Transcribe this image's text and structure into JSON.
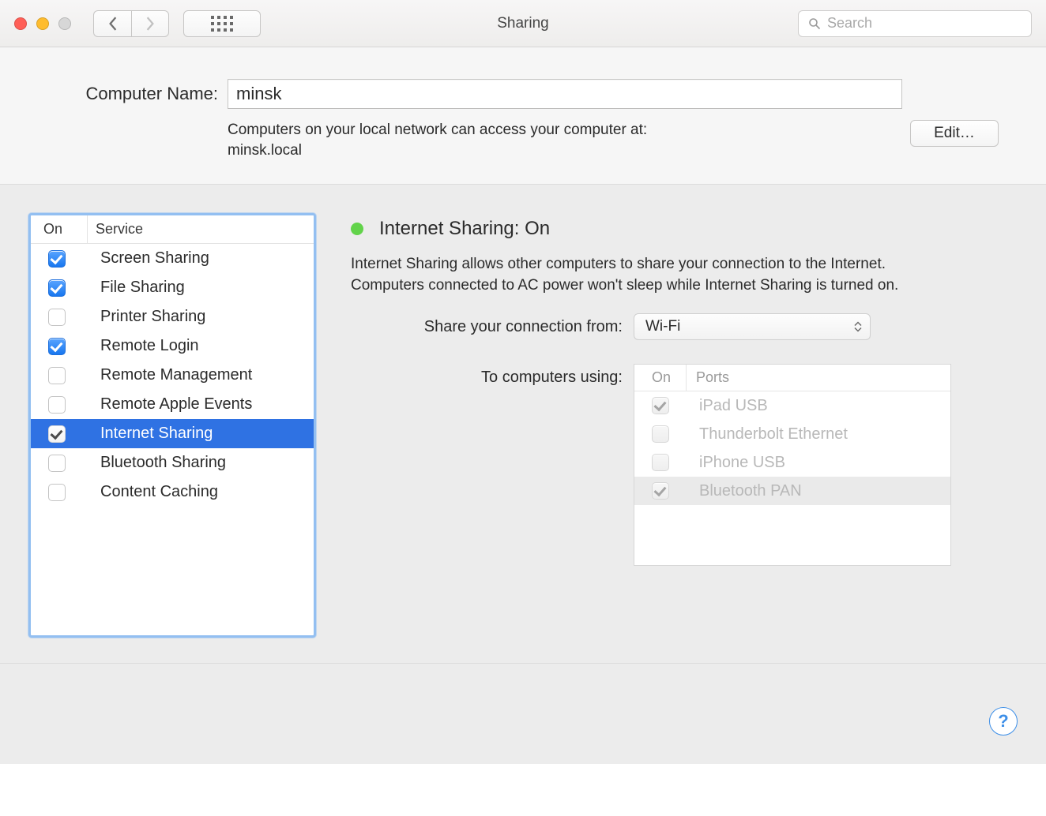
{
  "toolbar": {
    "window_title": "Sharing",
    "search_placeholder": "Search"
  },
  "computer_name": {
    "label": "Computer Name:",
    "value": "minsk",
    "hint_line1": "Computers on your local network can access your computer at:",
    "hint_line2": "minsk.local",
    "edit_label": "Edit…"
  },
  "services": {
    "header_on": "On",
    "header_service": "Service",
    "items": [
      {
        "label": "Screen Sharing",
        "checked": true,
        "selected": false
      },
      {
        "label": "File Sharing",
        "checked": true,
        "selected": false
      },
      {
        "label": "Printer Sharing",
        "checked": false,
        "selected": false
      },
      {
        "label": "Remote Login",
        "checked": true,
        "selected": false
      },
      {
        "label": "Remote Management",
        "checked": false,
        "selected": false
      },
      {
        "label": "Remote Apple Events",
        "checked": false,
        "selected": false
      },
      {
        "label": "Internet Sharing",
        "checked": true,
        "selected": true
      },
      {
        "label": "Bluetooth Sharing",
        "checked": false,
        "selected": false
      },
      {
        "label": "Content Caching",
        "checked": false,
        "selected": false
      }
    ]
  },
  "detail": {
    "title": "Internet Sharing: On",
    "status_color": "#62d34a",
    "description": "Internet Sharing allows other computers to share your connection to the Internet. Computers connected to AC power won't sleep while Internet Sharing is turned on.",
    "share_from_label": "Share your connection from:",
    "share_from_value": "Wi-Fi",
    "to_label": "To computers using:",
    "ports_header_on": "On",
    "ports_header_ports": "Ports",
    "ports": [
      {
        "label": "iPad USB",
        "checked": true,
        "alt": false
      },
      {
        "label": "Thunderbolt Ethernet",
        "checked": false,
        "alt": false
      },
      {
        "label": "iPhone USB",
        "checked": false,
        "alt": false
      },
      {
        "label": "Bluetooth PAN",
        "checked": true,
        "alt": true
      }
    ]
  },
  "help_label": "?"
}
